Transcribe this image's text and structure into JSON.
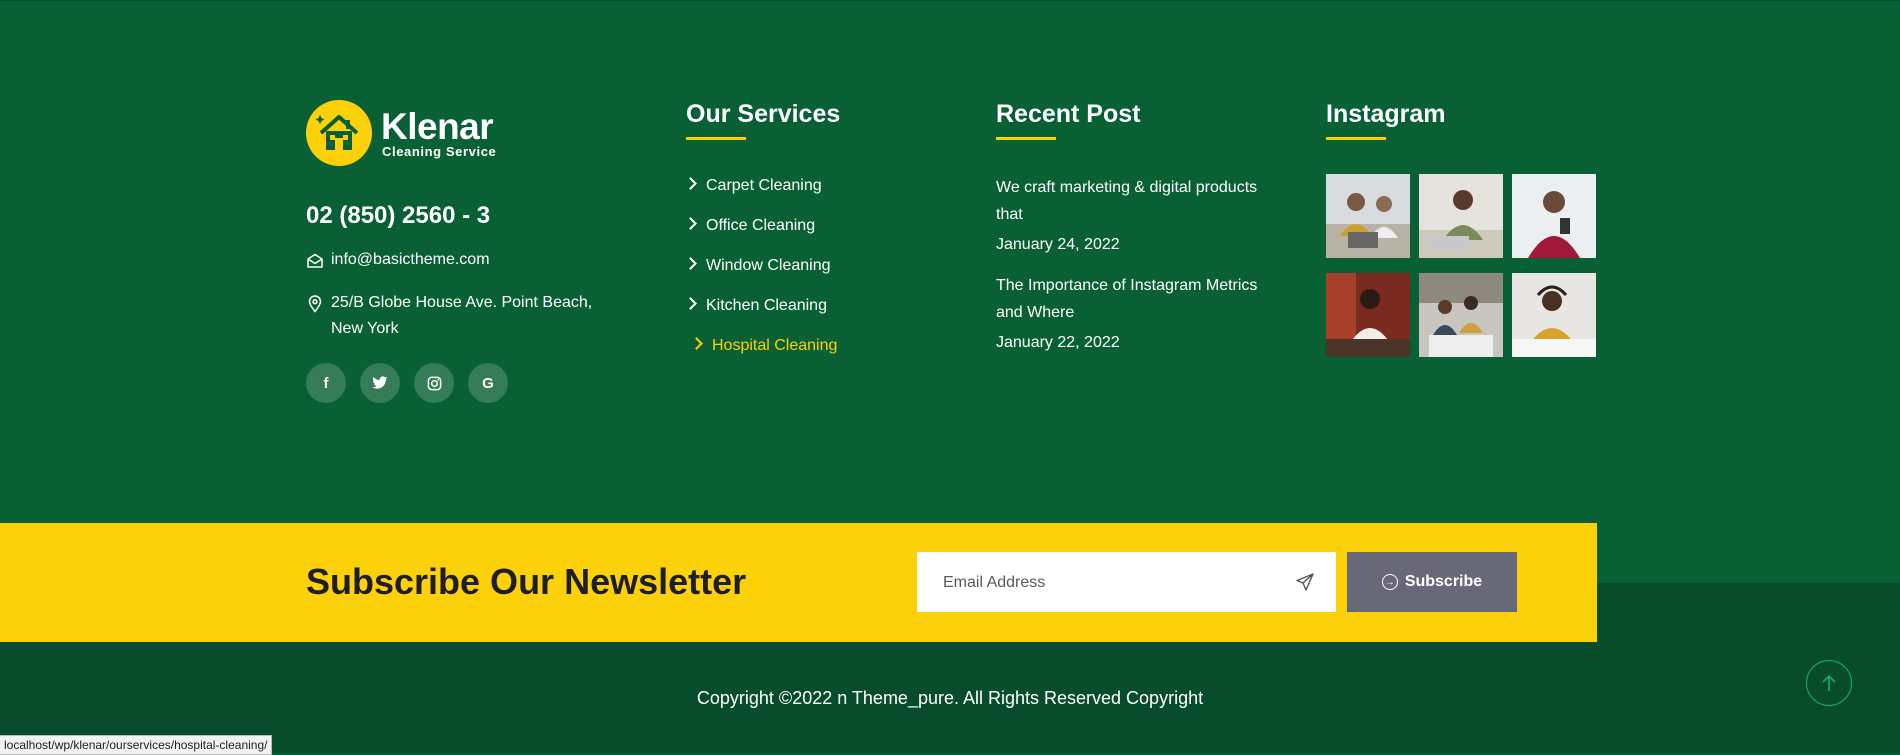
{
  "brand": {
    "name": "Klenar",
    "tagline": "Cleaning Service",
    "accent": "#fdd10a",
    "bg_green": "#096035"
  },
  "contact": {
    "phone": "02 (850) 2560 - 3",
    "email": "info@basictheme.com",
    "address": "25/B Globe House Ave. Point Beach, New York"
  },
  "socials": [
    {
      "icon": "facebook-icon",
      "glyph": "f"
    },
    {
      "icon": "twitter-icon",
      "glyph": "t"
    },
    {
      "icon": "instagram-icon",
      "glyph": "◎"
    },
    {
      "icon": "google-icon",
      "glyph": "G"
    }
  ],
  "services": {
    "title": "Our Services",
    "items": [
      "Carpet Cleaning",
      "Office Cleaning",
      "Window Cleaning",
      "Kitchen Cleaning",
      "Hospital Cleaning"
    ],
    "active_index": 4
  },
  "recent": {
    "title": "Recent Post",
    "posts": [
      {
        "title": "We craft marketing & digital products that",
        "date": "January 24, 2022"
      },
      {
        "title": "The Importance of Instagram Metrics and Where",
        "date": "January 22, 2022"
      }
    ]
  },
  "instagram": {
    "title": "Instagram",
    "photo_count": 6
  },
  "newsletter": {
    "title": "Subscribe Our Newsletter",
    "email_placeholder": "Email Address",
    "button_label": "Subscribe"
  },
  "footer": {
    "copyright": "Copyright ©2022 n Theme_pure. All Rights Reserved Copyright"
  },
  "status_bar": {
    "url": "localhost/wp/klenar/ourservices/hospital-cleaning/"
  }
}
